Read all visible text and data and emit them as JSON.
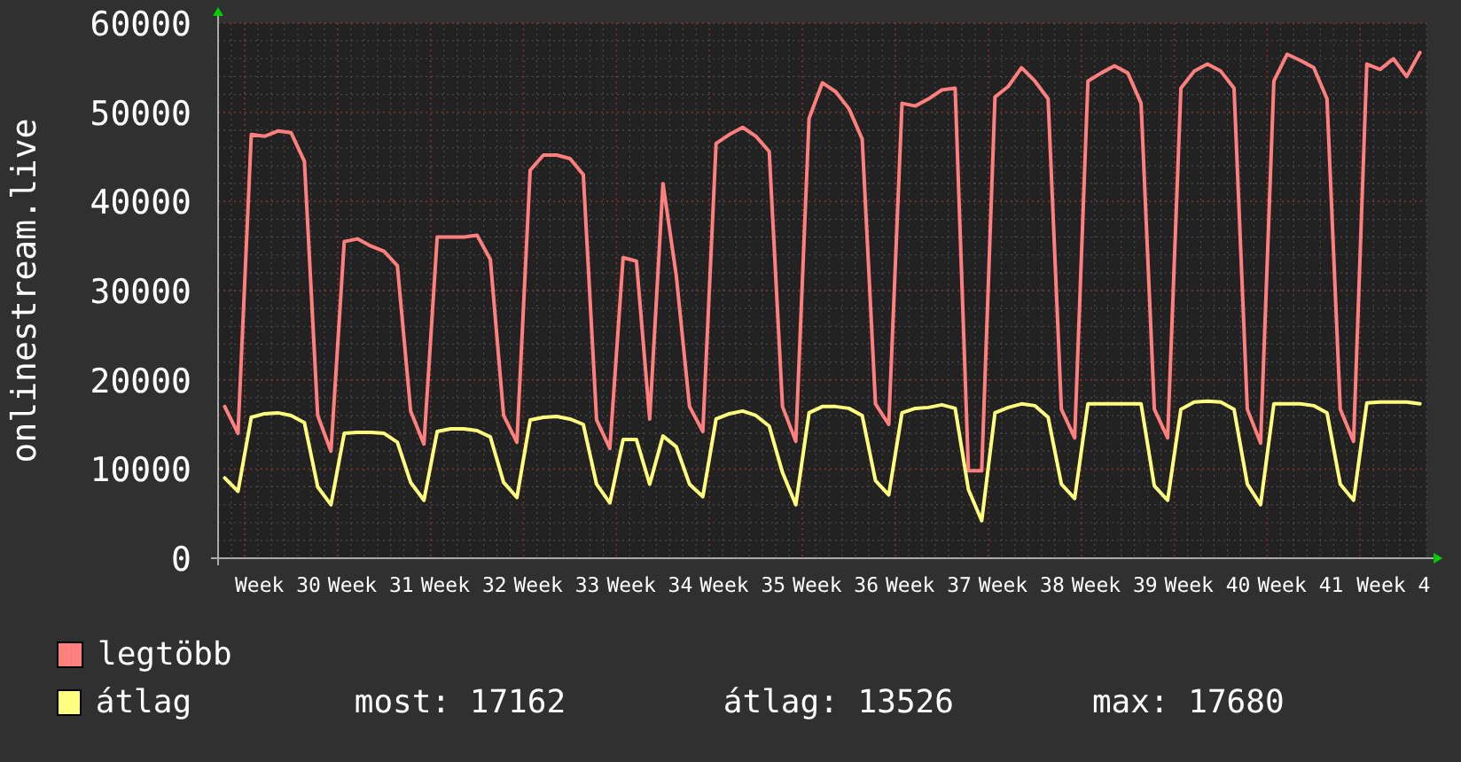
{
  "graph": {
    "chart_data": {
      "type": "line",
      "ylabel": "onlinestream.live",
      "grid": true,
      "categories": [
        null,
        null,
        null,
        null,
        "Week 30",
        null,
        null,
        null,
        null,
        null,
        null,
        "Week 31",
        null,
        null,
        null,
        null,
        null,
        null,
        "Week 32",
        null,
        null,
        null,
        null,
        null,
        null,
        "Week 33",
        null,
        null,
        null,
        null,
        null,
        null,
        "Week 34",
        null,
        null,
        null,
        null,
        null,
        null,
        "Week 35",
        null,
        null,
        null,
        null,
        null,
        null,
        "Week 36",
        null,
        null,
        null,
        null,
        null,
        null,
        "Week 37",
        null,
        null,
        null,
        null,
        null,
        null,
        "Week 38",
        null,
        null,
        null,
        null,
        null,
        null,
        "Week 39",
        null,
        null,
        null,
        null,
        null,
        null,
        "Week 40",
        null,
        null,
        null,
        null,
        null,
        null,
        "Week 41",
        null,
        null,
        null,
        null,
        null,
        null,
        "Week 4",
        null,
        null
      ],
      "ylim": [
        0,
        60000
      ],
      "yticks": [
        0,
        10000,
        20000,
        30000,
        40000,
        50000,
        60000
      ],
      "series": [
        {
          "name": "legtöbb",
          "color": "#ff7f7f",
          "values": [
            17000,
            14000,
            47500,
            47300,
            47900,
            47700,
            44500,
            16000,
            12000,
            35500,
            35800,
            35000,
            34400,
            32800,
            16500,
            12800,
            36000,
            36000,
            36000,
            36200,
            33500,
            16000,
            13000,
            43500,
            45200,
            45200,
            44800,
            43000,
            15500,
            12300,
            33700,
            33300,
            15600,
            42000,
            31700,
            17000,
            14200,
            46500,
            47500,
            48300,
            47300,
            45600,
            17000,
            13100,
            49300,
            53300,
            52300,
            50400,
            47000,
            17300,
            15000,
            51000,
            50700,
            51500,
            52500,
            52700,
            9800,
            9800,
            51700,
            52900,
            55000,
            53500,
            51500,
            16700,
            13500,
            53500,
            54400,
            55200,
            54400,
            51000,
            16700,
            13500,
            52700,
            54600,
            55400,
            54600,
            52700,
            16700,
            12900,
            53500,
            56500,
            55800,
            55000,
            51500,
            16700,
            13100,
            55400,
            54800,
            56000,
            54000,
            56700
          ]
        },
        {
          "name": "átlag",
          "color": "#ffff7f",
          "values": [
            9000,
            7500,
            15800,
            16200,
            16300,
            16000,
            15200,
            8000,
            6000,
            14000,
            14100,
            14100,
            14000,
            13000,
            8500,
            6500,
            14200,
            14500,
            14500,
            14300,
            13600,
            8500,
            6800,
            15500,
            15800,
            15900,
            15600,
            15000,
            8300,
            6200,
            13300,
            13300,
            8300,
            13700,
            12500,
            8300,
            6900,
            15600,
            16200,
            16500,
            16000,
            14800,
            9600,
            6000,
            16300,
            17000,
            17000,
            16800,
            16000,
            8700,
            7100,
            16300,
            16800,
            16900,
            17200,
            16800,
            7700,
            4200,
            16300,
            16900,
            17300,
            17100,
            15800,
            8300,
            6700,
            17300,
            17300,
            17300,
            17300,
            17300,
            8100,
            6500,
            16700,
            17500,
            17600,
            17500,
            16700,
            8300,
            6000,
            17300,
            17300,
            17300,
            17100,
            16300,
            8300,
            6500,
            17400,
            17500,
            17500,
            17500,
            17300
          ]
        }
      ]
    }
  },
  "legend_stats": [
    {
      "text": "most: 17162"
    },
    {
      "text": "átlag: 13526"
    },
    {
      "text": "max: 17680"
    }
  ]
}
